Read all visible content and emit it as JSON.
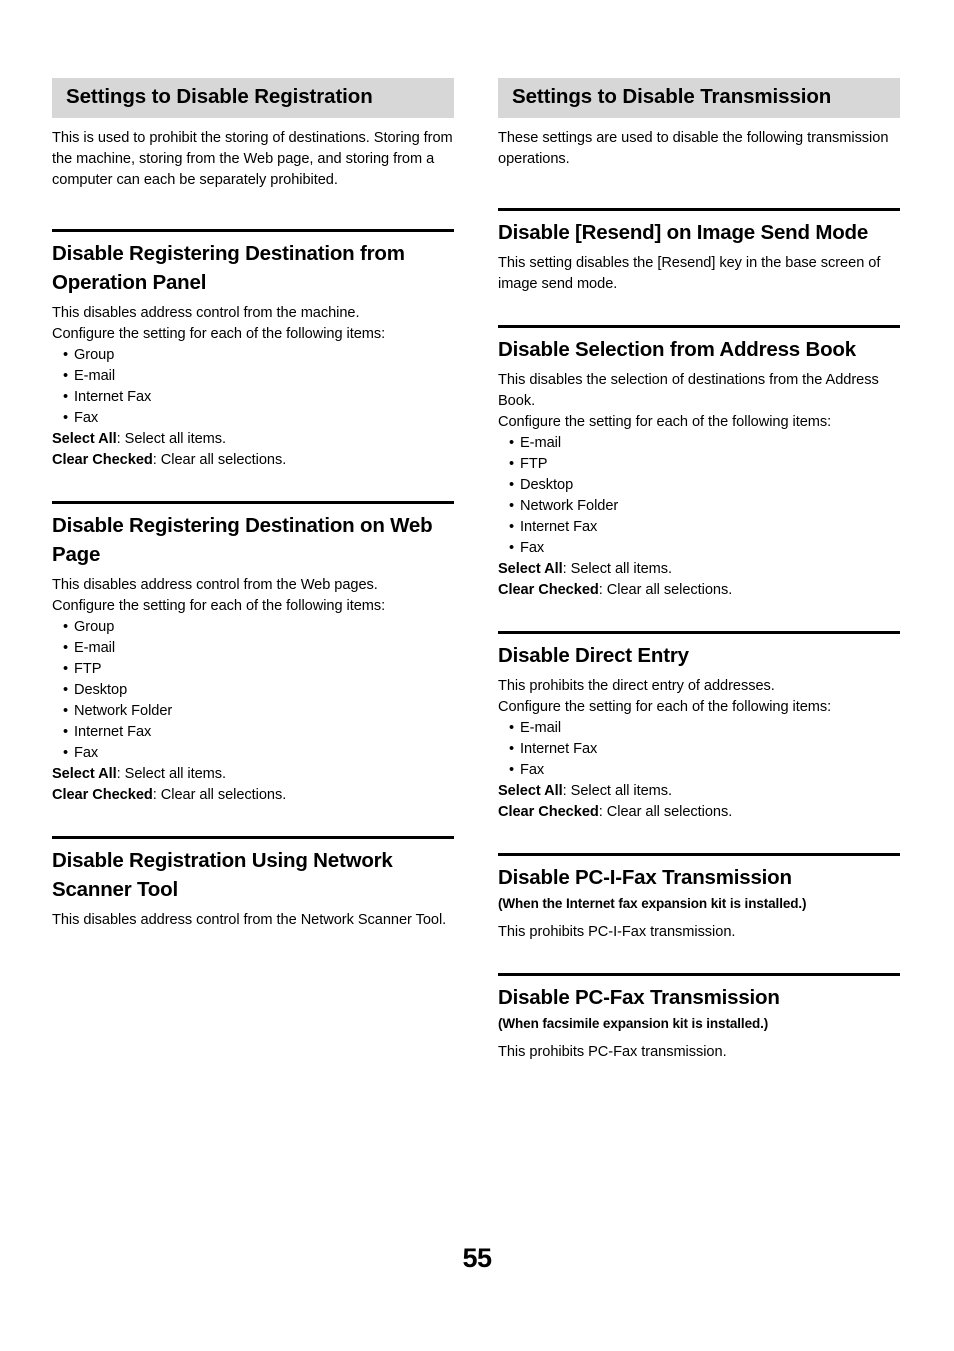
{
  "page": {
    "number": "55"
  },
  "left_column": {
    "banner": {
      "title": "Settings to Disable Registration",
      "intro": "This is used to prohibit the storing of destinations. Storing from the machine, storing from the Web page, and storing from a computer can each be separately prohibited."
    },
    "sections": [
      {
        "heading": "Disable Registering Destination from Operation Panel",
        "body1": "This disables address control from the machine.",
        "body2": "Configure the setting for each of the following items:",
        "bullets": [
          "Group",
          "E-mail",
          "Internet Fax",
          "Fax"
        ],
        "select_all_label": "Select All",
        "select_all_desc": ": Select all items.",
        "clear_checked_label": "Clear Checked",
        "clear_checked_desc": ": Clear all selections."
      },
      {
        "heading": "Disable Registering Destination on Web Page",
        "body1": "This disables address control from the Web pages.",
        "body2": "Configure the setting for each of the following items:",
        "bullets": [
          "Group",
          "E-mail",
          "FTP",
          "Desktop",
          "Network Folder",
          "Internet Fax",
          "Fax"
        ],
        "select_all_label": "Select All",
        "select_all_desc": ": Select all items.",
        "clear_checked_label": "Clear Checked",
        "clear_checked_desc": ": Clear all selections."
      },
      {
        "heading": "Disable Registration Using Network Scanner Tool",
        "body1": "This disables address control from the Network Scanner Tool."
      }
    ]
  },
  "right_column": {
    "banner": {
      "title": "Settings to Disable Transmission",
      "intro": "These settings are used to disable the following transmission operations."
    },
    "sections": [
      {
        "heading": "Disable [Resend] on Image Send Mode",
        "body1": "This setting disables the [Resend] key in the base screen of image send mode."
      },
      {
        "heading": "Disable Selection from Address Book",
        "body1": "This disables the selection of destinations from the Address Book.",
        "body2": "Configure the setting for each of the following items:",
        "bullets": [
          "E-mail",
          "FTP",
          "Desktop",
          "Network Folder",
          "Internet Fax",
          "Fax"
        ],
        "select_all_label": "Select All",
        "select_all_desc": ": Select all items.",
        "clear_checked_label": "Clear Checked",
        "clear_checked_desc": ": Clear all selections."
      },
      {
        "heading": "Disable Direct Entry",
        "body1": "This prohibits the direct entry of addresses.",
        "body2": "Configure the setting for each of the following items:",
        "bullets": [
          "E-mail",
          "Internet Fax",
          "Fax"
        ],
        "select_all_label": "Select All",
        "select_all_desc": ": Select all items.",
        "clear_checked_label": "Clear Checked",
        "clear_checked_desc": ": Clear all selections."
      },
      {
        "heading": "Disable PC-I-Fax Transmission",
        "subtitle": "(When the Internet fax expansion kit is installed.)",
        "body1": "This prohibits PC-I-Fax transmission."
      },
      {
        "heading": "Disable PC-Fax Transmission",
        "subtitle": "(When facsimile expansion kit is installed.)",
        "body1": "This prohibits PC-Fax transmission."
      }
    ]
  }
}
